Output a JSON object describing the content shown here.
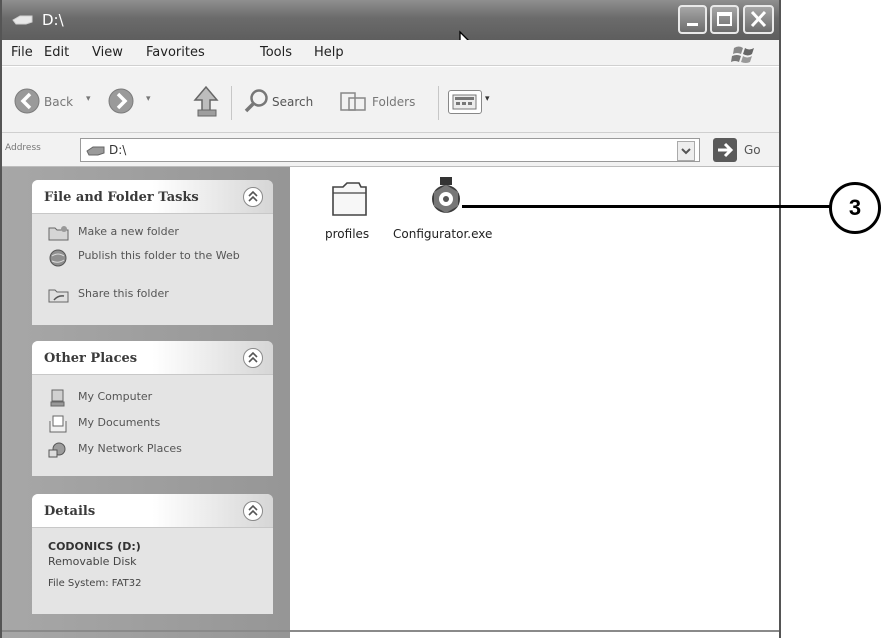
{
  "window": {
    "title": "D:\\",
    "controls": {
      "minimize": "minimize",
      "maximize": "maximize",
      "close": "close"
    }
  },
  "menu": [
    "File",
    "Edit",
    "View",
    "Favorites",
    "Tools",
    "Help"
  ],
  "toolbar": {
    "back_label": "Back",
    "search_label": "Search",
    "folders_label": "Folders"
  },
  "address": {
    "label": "Address",
    "value": "D:\\",
    "go_label": "Go"
  },
  "tasks": {
    "title": "File and Folder Tasks",
    "items": [
      {
        "label": "Make a new folder",
        "icon": "new-folder-icon"
      },
      {
        "label": "Publish this folder to the Web",
        "icon": "globe-icon"
      },
      {
        "label": "Share this folder",
        "icon": "share-icon"
      }
    ]
  },
  "other_places": {
    "title": "Other Places",
    "items": [
      {
        "label": "My Computer",
        "icon": "computer-icon"
      },
      {
        "label": "My Documents",
        "icon": "documents-icon"
      },
      {
        "label": "My Network Places",
        "icon": "network-icon"
      }
    ]
  },
  "details": {
    "title": "Details",
    "name": "CODONICS (D:)",
    "type": "Removable Disk",
    "file_system": "File System: FAT32"
  },
  "files": [
    {
      "name": "profiles",
      "icon": "folder-icon"
    },
    {
      "name": "Configurator.exe",
      "icon": "configurator-exe-icon"
    }
  ],
  "callout": {
    "number": "3"
  }
}
